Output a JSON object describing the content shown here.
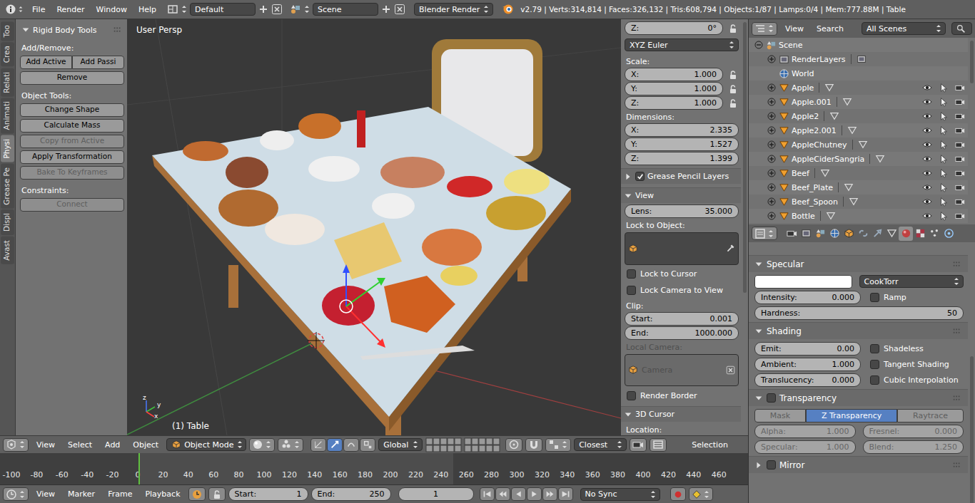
{
  "topbar": {
    "menus": [
      "File",
      "Render",
      "Window",
      "Help"
    ],
    "layout": "Default",
    "scene": "Scene",
    "engine": "Blender Render",
    "stats": "v2.79 | Verts:314,814 | Faces:326,132 | Tris:608,794 | Objects:1/87 | Lamps:0/4 | Mem:777.88M | Table"
  },
  "tool_tabs": [
    {
      "label": "Too",
      "selected": false
    },
    {
      "label": "Crea",
      "selected": false
    },
    {
      "label": "Relati",
      "selected": false
    },
    {
      "label": "Animati",
      "selected": false
    },
    {
      "label": "Physi",
      "selected": true
    },
    {
      "label": "Grease Pe",
      "selected": false
    },
    {
      "label": "Displ",
      "selected": false
    },
    {
      "label": "Avast",
      "selected": false
    }
  ],
  "tool_panel": {
    "title": "Rigid Body Tools",
    "expanded": true,
    "groups": [
      {
        "label": "Add/Remove:",
        "rows": [
          [
            {
              "label": "Add Active",
              "disabled": false
            },
            {
              "label": "Add Passi",
              "disabled": false
            }
          ],
          [
            {
              "label": "Remove",
              "disabled": false
            }
          ]
        ]
      },
      {
        "label": "Object Tools:",
        "rows": [
          [
            {
              "label": "Change Shape",
              "disabled": false
            }
          ],
          [
            {
              "label": "Calculate Mass",
              "disabled": false
            }
          ],
          [
            {
              "label": "Copy from Active",
              "disabled": true
            }
          ],
          [
            {
              "label": "Apply Transformation",
              "disabled": false
            }
          ],
          [
            {
              "label": "Bake To Keyframes",
              "disabled": true
            }
          ]
        ]
      },
      {
        "label": "Constraints:",
        "rows": [
          [
            {
              "label": "Connect",
              "disabled": true
            }
          ]
        ]
      }
    ]
  },
  "viewport": {
    "view_name": "User Persp",
    "active_object": "(1) Table",
    "gizmo_axes": [
      "x",
      "y",
      "z"
    ]
  },
  "n_panel": {
    "items": [
      {
        "kind": "field",
        "label": "Z:",
        "value": "0°",
        "lock": true
      },
      {
        "kind": "dropdown",
        "value": "XYZ Euler"
      },
      {
        "kind": "label",
        "text": "Scale:",
        "disabled": false
      },
      {
        "kind": "field",
        "label": "X:",
        "value": "1.000",
        "lock": true
      },
      {
        "kind": "field",
        "label": "Y:",
        "value": "1.000",
        "lock": true
      },
      {
        "kind": "field",
        "label": "Z:",
        "value": "1.000",
        "lock": true
      },
      {
        "kind": "label",
        "text": "Dimensions:",
        "disabled": false
      },
      {
        "kind": "field",
        "label": "X:",
        "value": "2.335",
        "lock": false
      },
      {
        "kind": "field",
        "label": "Y:",
        "value": "1.527",
        "lock": false
      },
      {
        "kind": "field",
        "label": "Z:",
        "value": "1.399",
        "lock": false
      },
      {
        "kind": "panel",
        "title": "Grease Pencil Layers",
        "expanded": false,
        "has_checkbox": true,
        "checked": true
      },
      {
        "kind": "panel",
        "title": "View",
        "expanded": true,
        "has_checkbox": false,
        "checked": false
      },
      {
        "kind": "field",
        "label": "Lens:",
        "value": "35.000",
        "lock": false
      },
      {
        "kind": "label",
        "text": "Lock to Object:",
        "disabled": false
      },
      {
        "kind": "object_field",
        "value": "",
        "disabled": false,
        "clearable": false
      },
      {
        "kind": "check",
        "label": "Lock to Cursor",
        "checked": false
      },
      {
        "kind": "check",
        "label": "Lock Camera to View",
        "checked": false
      },
      {
        "kind": "label",
        "text": "Clip:",
        "disabled": false
      },
      {
        "kind": "field",
        "label": "Start:",
        "value": "0.001",
        "lock": false
      },
      {
        "kind": "field",
        "label": "End:",
        "value": "1000.000",
        "lock": false
      },
      {
        "kind": "label",
        "text": "Local Camera:",
        "disabled": true
      },
      {
        "kind": "object_field",
        "value": "Camera",
        "disabled": true,
        "clearable": true
      },
      {
        "kind": "check",
        "label": "Render Border",
        "checked": false
      },
      {
        "kind": "panel",
        "title": "3D Cursor",
        "expanded": true,
        "has_checkbox": false,
        "checked": false
      },
      {
        "kind": "label",
        "text": "Location:",
        "disabled": false
      }
    ]
  },
  "outliner": {
    "menus": [
      "View",
      "Search"
    ],
    "filter": "All Scenes",
    "rows": [
      {
        "name": "Scene",
        "kind": "scene",
        "depth": 0,
        "expandable": true,
        "expanded": true,
        "visible": false,
        "selectable": false,
        "renderable": false
      },
      {
        "name": "RenderLayers",
        "kind": "renderlayers",
        "depth": 1,
        "expandable": true,
        "expanded": false,
        "visible": false,
        "selectable": false,
        "renderable": false
      },
      {
        "name": "World",
        "kind": "world",
        "depth": 1,
        "expandable": false,
        "expanded": false,
        "visible": false,
        "selectable": false,
        "renderable": false
      },
      {
        "name": "Apple",
        "kind": "object",
        "depth": 1,
        "expandable": true,
        "expanded": false,
        "visible": true,
        "selectable": true,
        "renderable": true
      },
      {
        "name": "Apple.001",
        "kind": "object",
        "depth": 1,
        "expandable": true,
        "expanded": false,
        "visible": true,
        "selectable": true,
        "renderable": true
      },
      {
        "name": "Apple2",
        "kind": "object",
        "depth": 1,
        "expandable": true,
        "expanded": false,
        "visible": true,
        "selectable": true,
        "renderable": true
      },
      {
        "name": "Apple2.001",
        "kind": "object",
        "depth": 1,
        "expandable": true,
        "expanded": false,
        "visible": true,
        "selectable": true,
        "renderable": true
      },
      {
        "name": "AppleChutney",
        "kind": "object",
        "depth": 1,
        "expandable": true,
        "expanded": false,
        "visible": true,
        "selectable": true,
        "renderable": true
      },
      {
        "name": "AppleCiderSangria",
        "kind": "object",
        "depth": 1,
        "expandable": true,
        "expanded": false,
        "visible": true,
        "selectable": true,
        "renderable": true
      },
      {
        "name": "Beef",
        "kind": "object",
        "depth": 1,
        "expandable": true,
        "expanded": false,
        "visible": true,
        "selectable": true,
        "renderable": true
      },
      {
        "name": "Beef_Plate",
        "kind": "object",
        "depth": 1,
        "expandable": true,
        "expanded": false,
        "visible": true,
        "selectable": true,
        "renderable": true
      },
      {
        "name": "Beef_Spoon",
        "kind": "object",
        "depth": 1,
        "expandable": true,
        "expanded": false,
        "visible": true,
        "selectable": true,
        "renderable": true
      },
      {
        "name": "Bottle",
        "kind": "object",
        "depth": 1,
        "expandable": true,
        "expanded": false,
        "visible": true,
        "selectable": true,
        "renderable": true
      }
    ]
  },
  "properties": {
    "tabs": [
      {
        "selected": false
      },
      {
        "selected": false
      },
      {
        "selected": false
      },
      {
        "selected": false
      },
      {
        "selected": false
      },
      {
        "selected": false
      },
      {
        "selected": false
      },
      {
        "selected": false
      },
      {
        "selected": true
      },
      {
        "selected": false
      },
      {
        "selected": false
      },
      {
        "selected": false
      }
    ],
    "panels": [
      {
        "title": "Specular",
        "expanded": true,
        "has_checkbox": false,
        "checked": false,
        "rows": [
          [
            {
              "kind": "swatch",
              "color": "#ffffff"
            },
            {
              "kind": "dropdown",
              "value": "CookTorr"
            }
          ],
          [
            {
              "kind": "field",
              "label": "Intensity:",
              "value": "0.000",
              "disabled": false
            },
            {
              "kind": "check",
              "label": "Ramp",
              "checked": false,
              "disabled": false
            }
          ],
          [
            {
              "kind": "field",
              "label": "Hardness:",
              "value": "50",
              "disabled": false
            }
          ]
        ]
      },
      {
        "title": "Shading",
        "expanded": true,
        "has_checkbox": false,
        "checked": false,
        "rows": [
          [
            {
              "kind": "field",
              "label": "Emit:",
              "value": "0.00",
              "disabled": false
            },
            {
              "kind": "check",
              "label": "Shadeless",
              "checked": false,
              "disabled": false
            }
          ],
          [
            {
              "kind": "field",
              "label": "Ambient:",
              "value": "1.000",
              "disabled": false
            },
            {
              "kind": "check",
              "label": "Tangent Shading",
              "checked": false,
              "disabled": false
            }
          ],
          [
            {
              "kind": "field",
              "label": "Translucency:",
              "value": "0.000",
              "disabled": false
            },
            {
              "kind": "check",
              "label": "Cubic Interpolation",
              "checked": false,
              "disabled": false
            }
          ]
        ]
      },
      {
        "title": "Transparency",
        "expanded": true,
        "has_checkbox": true,
        "checked": false,
        "rows": [
          [
            {
              "kind": "segmented",
              "disabled": true,
              "options": [
                {
                  "label": "Mask",
                  "selected": false
                },
                {
                  "label": "Z Transparency",
                  "selected": true
                },
                {
                  "label": "Raytrace",
                  "selected": false
                }
              ]
            }
          ],
          [
            {
              "kind": "field",
              "label": "Alpha:",
              "value": "1.000",
              "disabled": true
            },
            {
              "kind": "field",
              "label": "Fresnel:",
              "value": "0.000",
              "disabled": true
            }
          ],
          [
            {
              "kind": "field",
              "label": "Specular:",
              "value": "1.000",
              "disabled": true
            },
            {
              "kind": "field",
              "label": "Blend:",
              "value": "1.250",
              "disabled": true
            }
          ]
        ]
      },
      {
        "title": "Mirror",
        "expanded": false,
        "has_checkbox": true,
        "checked": false,
        "rows": []
      }
    ]
  },
  "view3d_header": {
    "menus": [
      "View",
      "Select",
      "Add",
      "Object"
    ],
    "mode": "Object Mode",
    "manipulators": [
      {
        "selected": false
      },
      {
        "selected": true
      },
      {
        "selected": false
      },
      {
        "selected": false
      }
    ],
    "orientation": "Global",
    "snap_element": "Closest",
    "selection": "Selection"
  },
  "timeline": {
    "ticks": [
      "-100",
      "-80",
      "-60",
      "-40",
      "-20",
      "0",
      "20",
      "40",
      "60",
      "80",
      "100",
      "120",
      "140",
      "160",
      "180",
      "200",
      "220",
      "240",
      "260",
      "280",
      "300",
      "320",
      "340",
      "360",
      "380",
      "400",
      "420",
      "440",
      "460"
    ],
    "menus": [
      "View",
      "Marker",
      "Frame",
      "Playback"
    ],
    "start_label": "Start:",
    "start": "1",
    "end_label": "End:",
    "end": "250",
    "current": "1",
    "sync": "No Sync"
  }
}
